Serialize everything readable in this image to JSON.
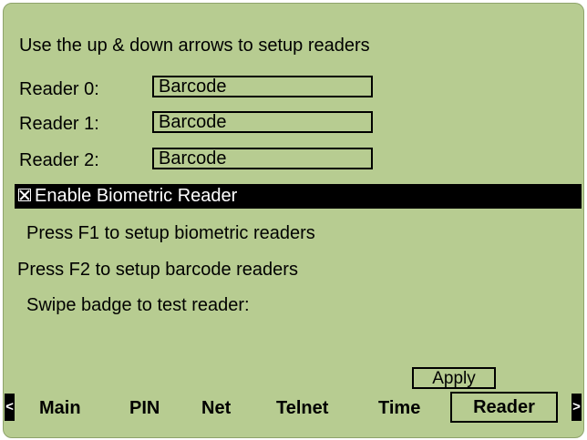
{
  "instruction": "Use the up & down arrows to setup readers",
  "readers": [
    {
      "label": "Reader 0:",
      "value": "Barcode"
    },
    {
      "label": "Reader 1:",
      "value": "Barcode"
    },
    {
      "label": "Reader 2:",
      "value": "Barcode"
    }
  ],
  "biometric": {
    "label": "Enable Biometric Reader",
    "checked": true
  },
  "hints": {
    "f1": "Press F1 to setup biometric readers",
    "f2": "Press F2 to setup barcode readers",
    "swipe": "Swipe badge to test reader:"
  },
  "apply_label": "Apply",
  "nav": {
    "left_arrow": "<",
    "right_arrow": ">",
    "tabs": [
      "Main",
      "PIN",
      "Net",
      "Telnet",
      "Time",
      "Reader"
    ],
    "selected": "Reader"
  },
  "colors": {
    "screen_bg": "#b7cc91",
    "highlight_bg": "#000000",
    "highlight_fg": "#ffffff"
  }
}
